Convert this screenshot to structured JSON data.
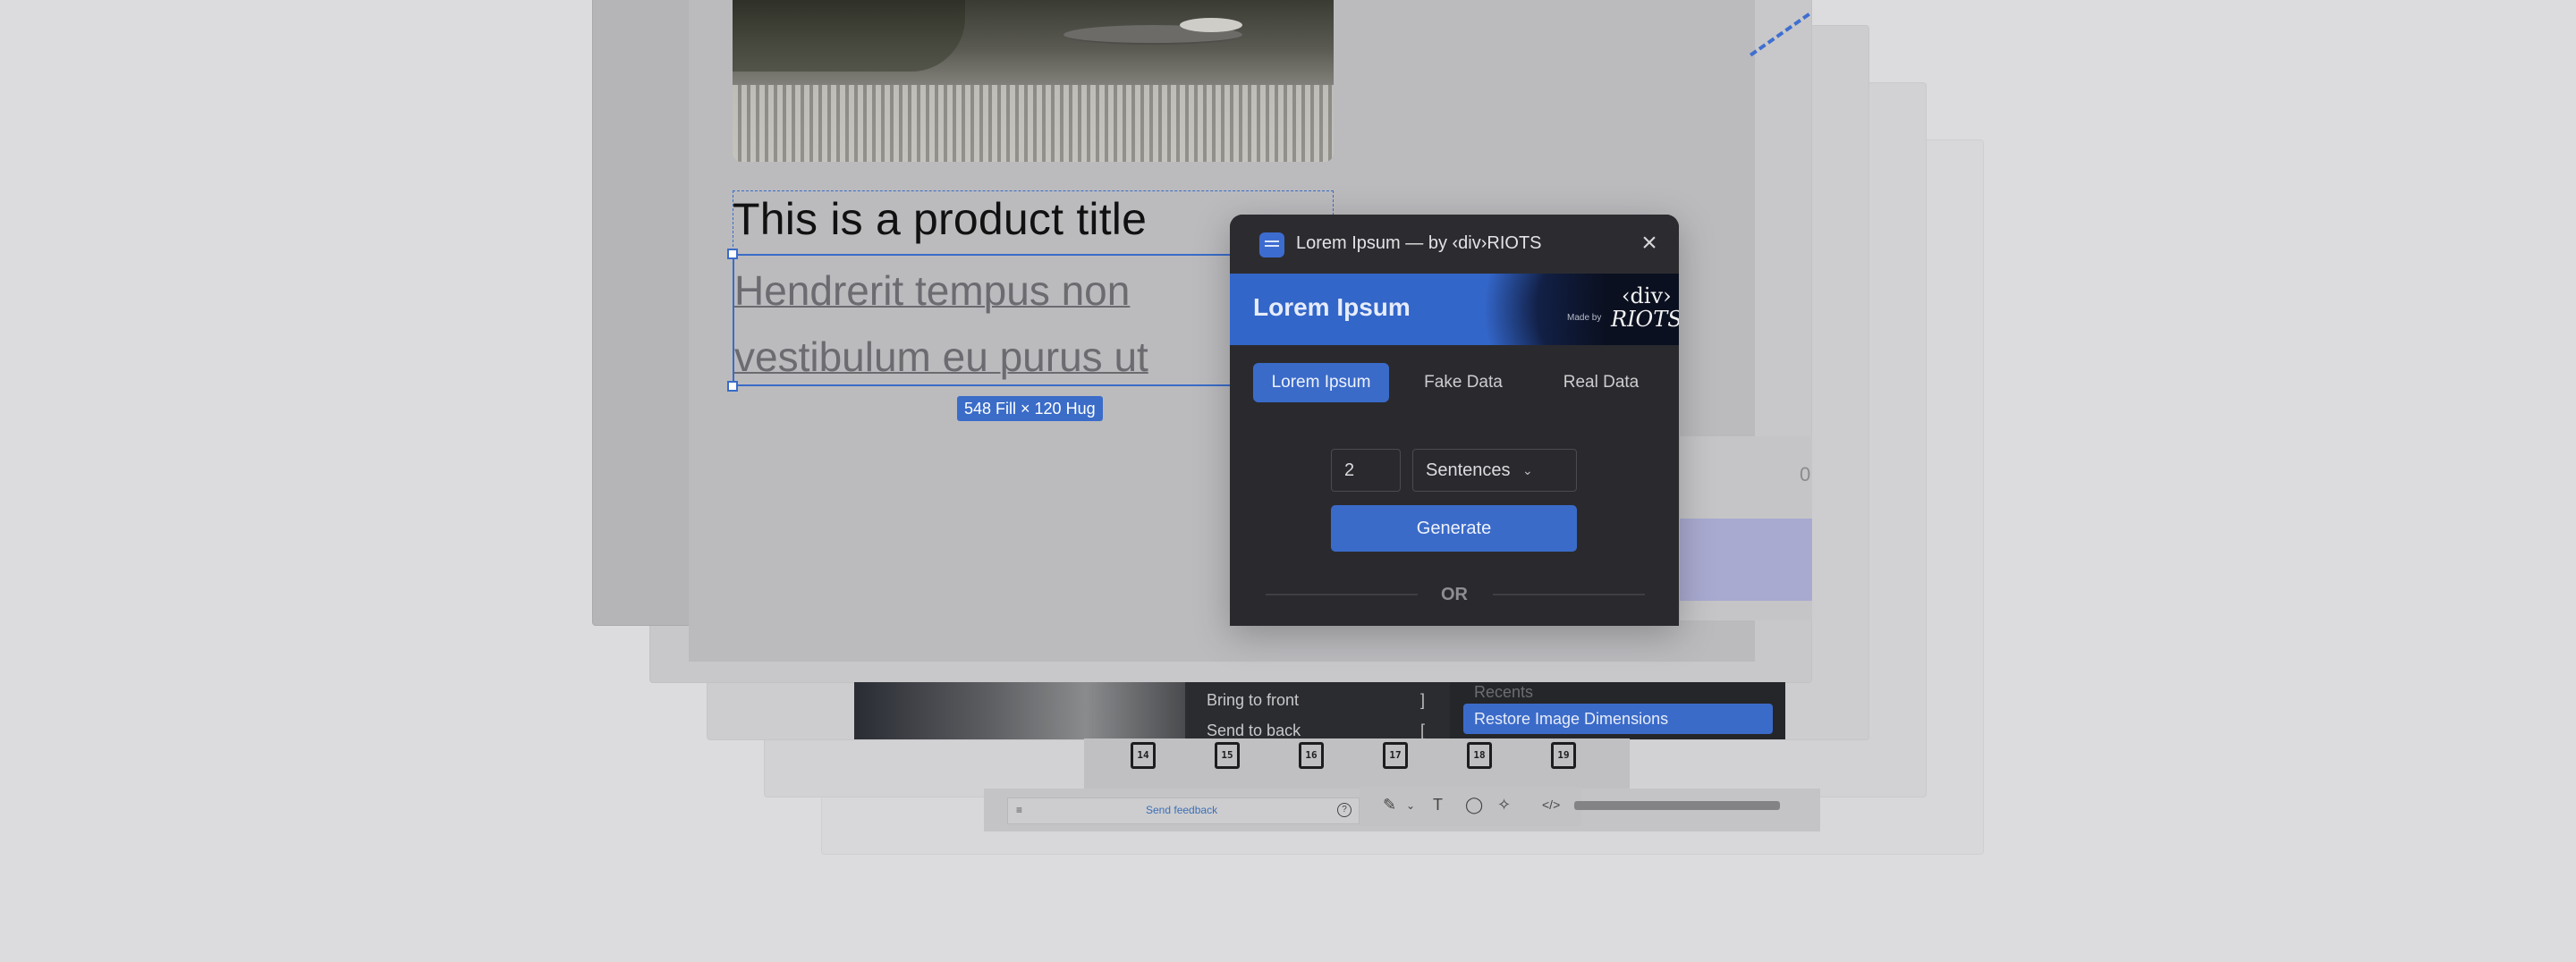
{
  "canvas": {
    "product_title": "This is a product title",
    "lorem_line_1": "Hendrerit tempus non",
    "lorem_line_2": "vestibulum eu purus ut",
    "size_badge": "548 Fill × 120 Hug",
    "partial_value": "0"
  },
  "context_menu": {
    "items": [
      {
        "label": "Bring to front",
        "shortcut": "]"
      },
      {
        "label": "Send to back",
        "shortcut": "["
      }
    ]
  },
  "plugin_menu": {
    "recents_label": "Recents",
    "restore_item": "Restore Image Dimensions"
  },
  "calendar_icons": [
    "14",
    "15",
    "16",
    "17",
    "18",
    "19"
  ],
  "feedback": {
    "link": "Send feedback",
    "help": "?"
  },
  "plugin": {
    "title": "Lorem Ipsum — by ‹div›RIOTS",
    "banner_title": "Lorem Ipsum",
    "banner_made_by": "Made by",
    "banner_brand_line1": "‹div›",
    "banner_brand_line2": "RIOTS",
    "tabs": [
      {
        "label": "Lorem Ipsum",
        "active": true
      },
      {
        "label": "Fake Data",
        "active": false
      },
      {
        "label": "Real Data",
        "active": false
      }
    ],
    "count_value": "2",
    "unit_selected": "Sentences",
    "generate_label": "Generate",
    "or_label": "OR"
  },
  "colors": {
    "accent": "#3b6bc9",
    "selection": "#3a6cc8",
    "plugin_bg": "#2a2a2e"
  }
}
